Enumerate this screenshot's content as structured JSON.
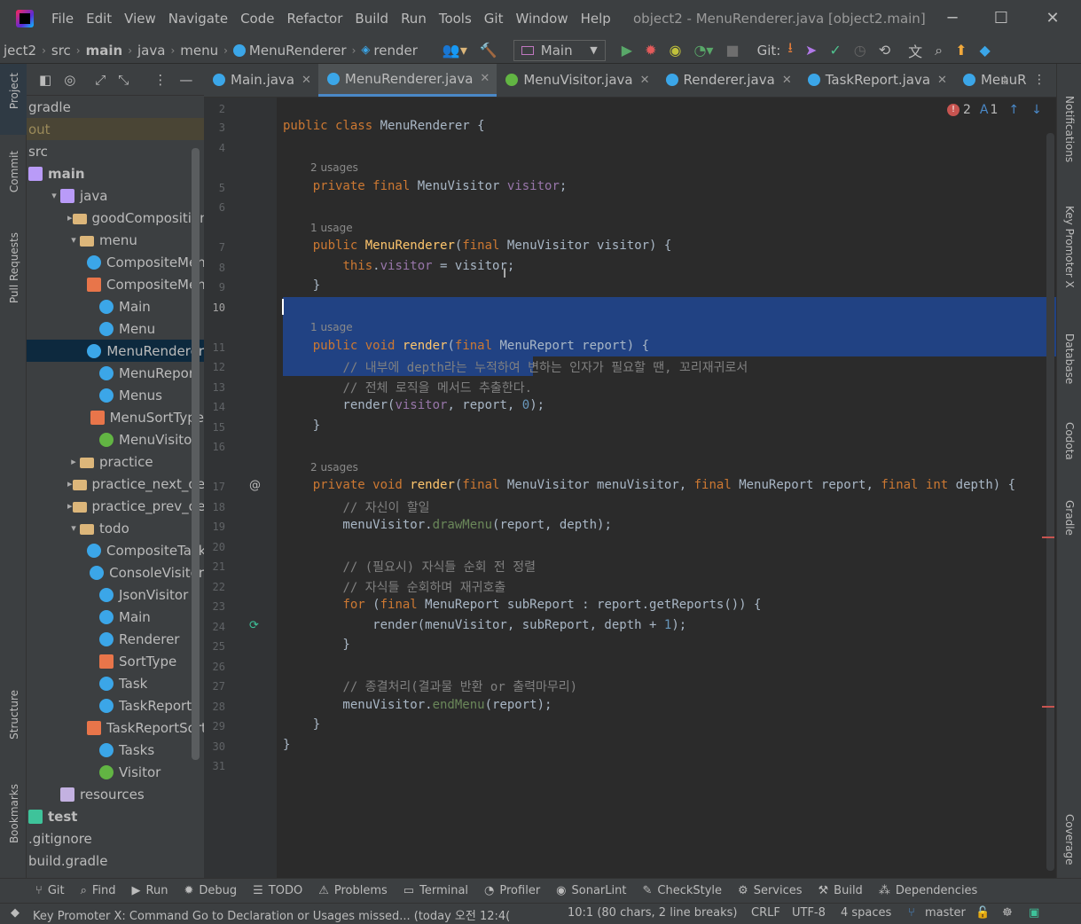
{
  "window": {
    "title": "object2 - MenuRenderer.java [object2.main]",
    "menu": [
      "File",
      "Edit",
      "View",
      "Navigate",
      "Code",
      "Refactor",
      "Build",
      "Run",
      "Tools",
      "Git",
      "Window",
      "Help"
    ]
  },
  "nav": {
    "crumbs": [
      "ject2",
      "src",
      "main",
      "java",
      "menu",
      "MenuRenderer",
      "render"
    ],
    "run_config": "Main",
    "git_label": "Git:"
  },
  "left_stripe": [
    "Project",
    "Commit",
    "Pull Requests",
    "Structure",
    "Bookmarks"
  ],
  "right_stripe": [
    "Notifications",
    "Key Promoter X",
    "Database",
    "Codota",
    "Gradle",
    "Coverage"
  ],
  "tree": [
    {
      "label": "gradle",
      "depth": 0,
      "icon": "none",
      "arrow": ""
    },
    {
      "label": "out",
      "depth": 0,
      "icon": "none",
      "arrow": "",
      "muted": true
    },
    {
      "label": "src",
      "depth": 0,
      "icon": "none",
      "arrow": ""
    },
    {
      "label": "main",
      "depth": 0,
      "icon": "pkg",
      "arrow": "",
      "bold": true
    },
    {
      "label": "java",
      "depth": 1,
      "icon": "pkg",
      "arrow": "▾"
    },
    {
      "label": "goodComposition",
      "depth": 2,
      "icon": "folder",
      "arrow": "▸"
    },
    {
      "label": "menu",
      "depth": 2,
      "icon": "folder",
      "arrow": "▾"
    },
    {
      "label": "CompositeMenu",
      "depth": 3,
      "icon": "cls",
      "arrow": ""
    },
    {
      "label": "CompositeMenu",
      "depth": 3,
      "icon": "enum",
      "arrow": ""
    },
    {
      "label": "Main",
      "depth": 3,
      "icon": "cls",
      "arrow": ""
    },
    {
      "label": "Menu",
      "depth": 3,
      "icon": "cls",
      "arrow": ""
    },
    {
      "label": "MenuRenderer",
      "depth": 3,
      "icon": "cls",
      "arrow": "",
      "selected": true
    },
    {
      "label": "MenuReport",
      "depth": 3,
      "icon": "cls",
      "arrow": ""
    },
    {
      "label": "Menus",
      "depth": 3,
      "icon": "cls",
      "arrow": ""
    },
    {
      "label": "MenuSortType",
      "depth": 3,
      "icon": "enum",
      "arrow": ""
    },
    {
      "label": "MenuVisitor",
      "depth": 3,
      "icon": "intf",
      "arrow": ""
    },
    {
      "label": "practice",
      "depth": 2,
      "icon": "folder",
      "arrow": "▸"
    },
    {
      "label": "practice_next_deco_",
      "depth": 2,
      "icon": "folder",
      "arrow": "▸"
    },
    {
      "label": "practice_prev_deco_",
      "depth": 2,
      "icon": "folder",
      "arrow": "▸"
    },
    {
      "label": "todo",
      "depth": 2,
      "icon": "folder",
      "arrow": "▾"
    },
    {
      "label": "CompositeTask",
      "depth": 3,
      "icon": "cls",
      "arrow": ""
    },
    {
      "label": "ConsoleVisitor",
      "depth": 3,
      "icon": "cls",
      "arrow": ""
    },
    {
      "label": "JsonVisitor",
      "depth": 3,
      "icon": "cls",
      "arrow": ""
    },
    {
      "label": "Main",
      "depth": 3,
      "icon": "cls",
      "arrow": ""
    },
    {
      "label": "Renderer",
      "depth": 3,
      "icon": "cls",
      "arrow": ""
    },
    {
      "label": "SortType",
      "depth": 3,
      "icon": "enum",
      "arrow": ""
    },
    {
      "label": "Task",
      "depth": 3,
      "icon": "cls",
      "arrow": ""
    },
    {
      "label": "TaskReport",
      "depth": 3,
      "icon": "cls",
      "arrow": ""
    },
    {
      "label": "TaskReportSortT",
      "depth": 3,
      "icon": "enum",
      "arrow": ""
    },
    {
      "label": "Tasks",
      "depth": 3,
      "icon": "cls",
      "arrow": ""
    },
    {
      "label": "Visitor",
      "depth": 3,
      "icon": "intf",
      "arrow": ""
    },
    {
      "label": "resources",
      "depth": 1,
      "icon": "res",
      "arrow": ""
    },
    {
      "label": "test",
      "depth": 0,
      "icon": "test",
      "arrow": "",
      "bold": true
    },
    {
      "label": ".gitignore",
      "depth": 0,
      "icon": "none",
      "arrow": ""
    },
    {
      "label": "build.gradle",
      "depth": 0,
      "icon": "none",
      "arrow": ""
    }
  ],
  "tabs": [
    {
      "label": "Main.java",
      "active": false
    },
    {
      "label": "MenuRenderer.java",
      "active": true
    },
    {
      "label": "MenuVisitor.java",
      "active": false
    },
    {
      "label": "Renderer.java",
      "active": false
    },
    {
      "label": "TaskReport.java",
      "active": false
    },
    {
      "label": "MenuR",
      "active": false
    }
  ],
  "inspections": {
    "errors": "2",
    "typos": "1"
  },
  "usage_hints": [
    {
      "line": 5,
      "text": "2 usages"
    },
    {
      "line": 7,
      "text": "1 usage"
    },
    {
      "line": 11,
      "text": "1 usage"
    },
    {
      "line": 17,
      "text": "2 usages"
    }
  ],
  "code_lines": [
    {
      "n": "2",
      "html": ""
    },
    {
      "n": "3",
      "html": "<span class=\"kw\">public class </span>MenuRenderer {"
    },
    {
      "n": "4",
      "html": ""
    },
    {
      "n": "5",
      "html": "    <span class=\"kw\">private final </span>MenuVisitor <span class=\"fld\">visitor</span>;"
    },
    {
      "n": "6",
      "html": ""
    },
    {
      "n": "7",
      "html": "    <span class=\"kw\">public </span><span class=\"fn\">MenuRenderer</span>(<span class=\"kw\">final </span>MenuVisitor visitor) {"
    },
    {
      "n": "8",
      "html": "        <span class=\"kw\">this</span>.<span class=\"fld\">visitor</span> = visitor;"
    },
    {
      "n": "9",
      "html": "    }"
    },
    {
      "n": "10",
      "html": ""
    },
    {
      "n": "11",
      "html": "    <span class=\"kw\">public void </span><span class=\"fn\">render</span>(<span class=\"kw\">final </span>MenuReport report) {"
    },
    {
      "n": "12",
      "html": "        <span class=\"cm\">// 내부에 depth라는 누적하여 변하는 인자가 필요할 땐, 꼬리재귀로서</span>"
    },
    {
      "n": "13",
      "html": "        <span class=\"cm\">// 전체 로직을 메서드 추출한다.</span>"
    },
    {
      "n": "14",
      "html": "        render(<span class=\"fld\">visitor</span>, report, <span class=\"num\">0</span>);"
    },
    {
      "n": "15",
      "html": "    }"
    },
    {
      "n": "16",
      "html": ""
    },
    {
      "n": "17",
      "html": "    <span class=\"kw\">private void </span><span class=\"fn\">render</span>(<span class=\"kw\">final </span>MenuVisitor menuVisitor, <span class=\"kw\">final </span>MenuReport report, <span class=\"kw\">final int </span>depth) {"
    },
    {
      "n": "18",
      "html": "        <span class=\"cm\">// 자신이 할일</span>"
    },
    {
      "n": "19",
      "html": "        menuVisitor.<span class=\"str\">drawMenu</span>(report, depth);"
    },
    {
      "n": "20",
      "html": ""
    },
    {
      "n": "21",
      "html": "        <span class=\"cm\">// (필요시) 자식들 순회 전 정렬</span>"
    },
    {
      "n": "22",
      "html": "        <span class=\"cm\">// 자식들 순회하며 재귀호출</span>"
    },
    {
      "n": "23",
      "html": "        <span class=\"kw\">for </span>(<span class=\"kw\">final </span>MenuReport subReport : report.getReports()) {"
    },
    {
      "n": "24",
      "html": "            render(menuVisitor, subReport, depth + <span class=\"num\">1</span>);"
    },
    {
      "n": "25",
      "html": "        }"
    },
    {
      "n": "26",
      "html": ""
    },
    {
      "n": "27",
      "html": "        <span class=\"cm\">// 종결처리(결과물 반환 or 출력마무리)</span>"
    },
    {
      "n": "28",
      "html": "        menuVisitor.<span class=\"str\">endMenu</span>(report);"
    },
    {
      "n": "29",
      "html": "    }"
    },
    {
      "n": "30",
      "html": "}"
    },
    {
      "n": "31",
      "html": ""
    }
  ],
  "tool_windows": [
    "Git",
    "Find",
    "Run",
    "Debug",
    "TODO",
    "Problems",
    "Terminal",
    "Profiler",
    "SonarLint",
    "CheckStyle",
    "Services",
    "Build",
    "Dependencies"
  ],
  "status": {
    "message": "Key Promoter X: Command Go to Declaration or Usages missed... (today 오전 12:4(",
    "position": "10:1 (80 chars, 2 line breaks)",
    "line_sep": "CRLF",
    "encoding": "UTF-8",
    "indent": "4 spaces",
    "branch": "master"
  },
  "colors": {
    "accent": "#4a88c7",
    "selection": "#214283",
    "keyword": "#cc7832",
    "function": "#ffc66d",
    "field": "#9876aa"
  }
}
